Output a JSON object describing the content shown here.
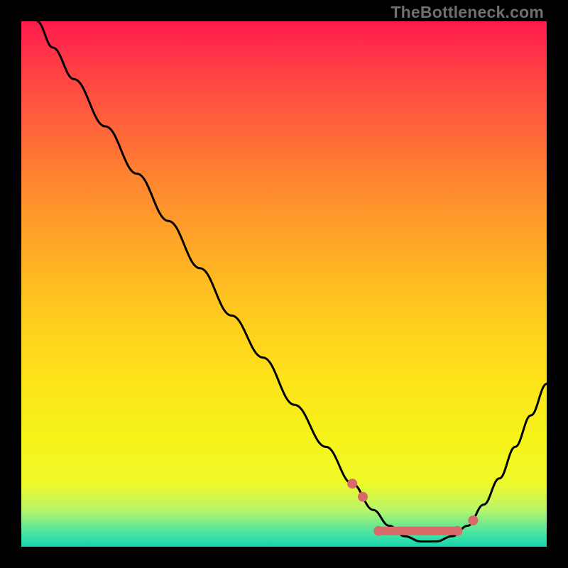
{
  "watermark": "TheBottleneck.com",
  "chart_data": {
    "type": "line",
    "title": "",
    "xlabel": "",
    "ylabel": "",
    "xlim": [
      0,
      100
    ],
    "ylim": [
      0,
      100
    ],
    "grid": false,
    "series": [
      {
        "name": "bottleneck-curve",
        "x": [
          3,
          6,
          10,
          16,
          22,
          28,
          34,
          40,
          46,
          52,
          58,
          63,
          67,
          70,
          73,
          76,
          79,
          82,
          85,
          88,
          91,
          94,
          97,
          100
        ],
        "values": [
          100,
          95,
          89,
          80,
          71,
          62,
          53,
          44,
          36,
          27,
          19,
          12,
          7,
          4,
          2,
          1,
          1,
          2,
          4,
          8,
          13,
          19,
          25,
          31
        ]
      }
    ],
    "markers": {
      "name": "highlight-points",
      "points": [
        {
          "x": 63,
          "y": 12
        },
        {
          "x": 65,
          "y": 9.5
        },
        {
          "x": 86,
          "y": 5
        }
      ],
      "pills": [
        {
          "x0": 68,
          "x1": 83,
          "y": 3
        }
      ]
    },
    "colors": {
      "gradient_top": "#ff1a4d",
      "gradient_mid": "#ffe41c",
      "gradient_bottom": "#14d7b0",
      "curve": "#000000",
      "marker": "#d96a6a"
    }
  }
}
